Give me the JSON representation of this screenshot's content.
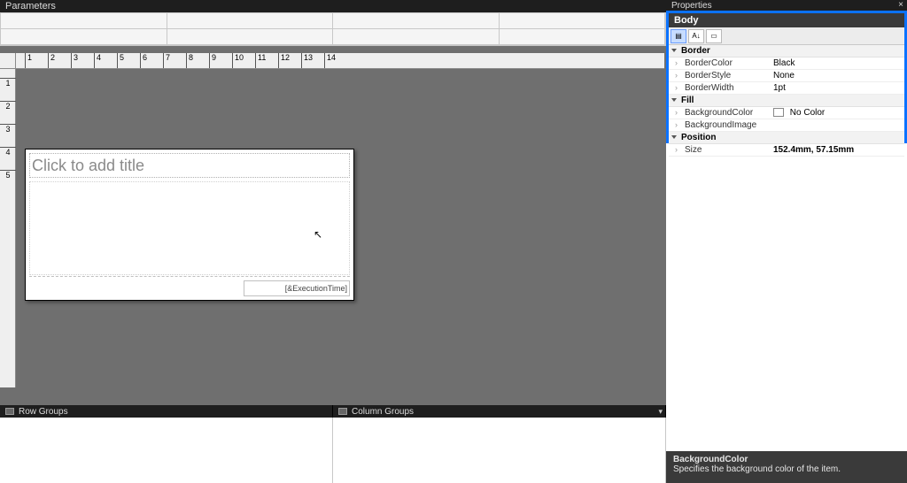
{
  "parametersPanel": {
    "title": "Parameters"
  },
  "ruler": {
    "hTicks": [
      "1",
      "2",
      "3",
      "4",
      "5",
      "6",
      "7",
      "8",
      "9",
      "10",
      "11",
      "12",
      "13",
      "14"
    ],
    "vTicks": [
      "1",
      "2",
      "3",
      "4",
      "5"
    ]
  },
  "report": {
    "titlePlaceholder": "Click to add title",
    "footerExpr": "[&ExecutionTime]"
  },
  "groupsBar": {
    "rowGroups": "Row Groups",
    "columnGroups": "Column Groups"
  },
  "properties": {
    "panelTitle": "Properties",
    "header": "Body",
    "categories": {
      "border": "Border",
      "fill": "Fill",
      "position": "Position"
    },
    "rows": {
      "borderColor": {
        "name": "BorderColor",
        "value": "Black"
      },
      "borderStyle": {
        "name": "BorderStyle",
        "value": "None"
      },
      "borderWidth": {
        "name": "BorderWidth",
        "value": "1pt"
      },
      "backgroundColor": {
        "name": "BackgroundColor",
        "value": "No Color"
      },
      "backgroundImage": {
        "name": "BackgroundImage",
        "value": ""
      },
      "size": {
        "name": "Size",
        "value": "152.4mm, 57.15mm"
      }
    },
    "description": {
      "title": "BackgroundColor",
      "text": "Specifies the background color of the item."
    }
  }
}
